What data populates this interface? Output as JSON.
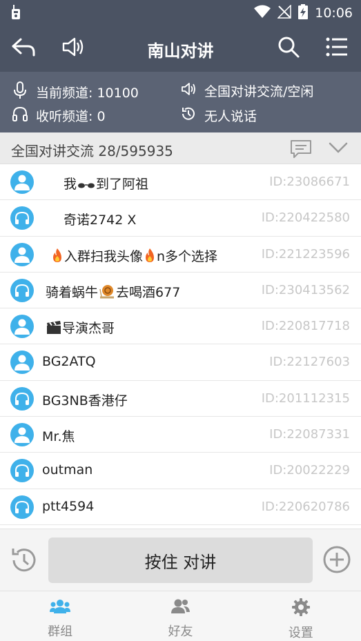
{
  "status": {
    "time": "10:06"
  },
  "toolbar": {
    "title": "南山对讲"
  },
  "info": {
    "current_channel": "当前频道: 10100",
    "listen_channel": "收听频道: 0",
    "group_status": "全国对讲交流/空闲",
    "speaker_status": "无人说话"
  },
  "group": {
    "title": "全国对讲交流 28/595935"
  },
  "members": [
    {
      "pre": "",
      "name_a": "我",
      "emoji": "glasses-emoji",
      "name_b": "到了阿祖",
      "id": "ID:23086671",
      "icon": "person",
      "indent": 92
    },
    {
      "pre": "",
      "name_a": "奇诺2742 X",
      "emoji": "",
      "name_b": "",
      "id": "ID:220422580",
      "icon": "headphones",
      "indent": 92
    },
    {
      "pre": "fire-emoji",
      "name_a": "入群扫我头像",
      "emoji": "fire-emoji",
      "name_b": "n多个选择",
      "id": "ID:221223596",
      "icon": "person",
      "indent": 73
    },
    {
      "pre": "",
      "name_a": "骑着蜗牛",
      "emoji": "snail-emoji",
      "name_b": "去喝酒677",
      "id": "ID:230413562",
      "icon": "headphones",
      "indent": 66
    },
    {
      "pre": "clapper-emoji",
      "name_a": "导演杰哥",
      "emoji": "",
      "name_b": "",
      "id": "ID:220817718",
      "icon": "person",
      "indent": 66
    },
    {
      "pre": "",
      "name_a": "BG2ATQ",
      "emoji": "",
      "name_b": "",
      "id": "ID:22127603",
      "icon": "person",
      "indent": 61
    },
    {
      "pre": "",
      "name_a": "BG3NB香港仔",
      "emoji": "",
      "name_b": "",
      "id": "ID:201112315",
      "icon": "headphones",
      "indent": 61
    },
    {
      "pre": "",
      "name_a": "Mr.焦",
      "emoji": "",
      "name_b": "",
      "id": "ID:22087331",
      "icon": "person",
      "indent": 61
    },
    {
      "pre": "",
      "name_a": "outman",
      "emoji": "",
      "name_b": "",
      "id": "ID:20022229",
      "icon": "headphones",
      "indent": 61
    },
    {
      "pre": "",
      "name_a": "ptt4594",
      "emoji": "",
      "name_b": "",
      "id": "ID:220620786",
      "icon": "headphones",
      "indent": 61
    }
  ],
  "ptt": {
    "label": "按住 对讲"
  },
  "tabs": [
    {
      "label": "群组",
      "icon": "group-icon"
    },
    {
      "label": "好友",
      "icon": "friends-icon"
    },
    {
      "label": "设置",
      "icon": "settings-icon"
    }
  ]
}
